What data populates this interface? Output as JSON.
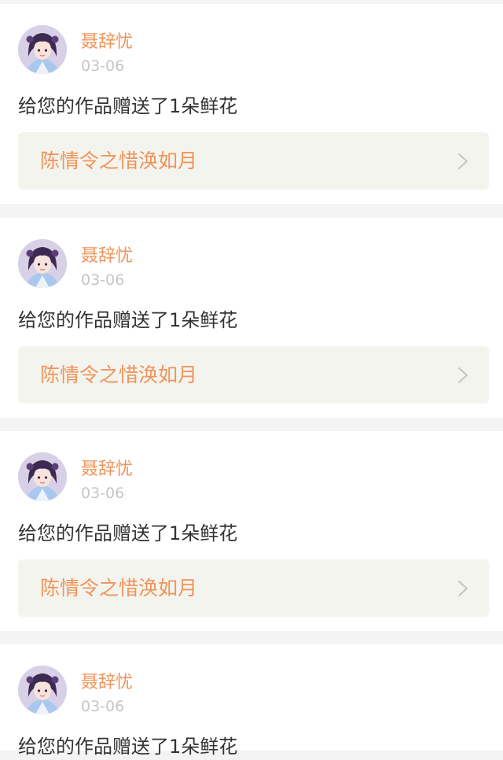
{
  "notifications": [
    {
      "username": "聂辞忧",
      "date": "03-06",
      "message": "给您的作品赠送了1朵鲜花",
      "work_title": "陈情令之惜涣如月"
    },
    {
      "username": "聂辞忧",
      "date": "03-06",
      "message": "给您的作品赠送了1朵鲜花",
      "work_title": "陈情令之惜涣如月"
    },
    {
      "username": "聂辞忧",
      "date": "03-06",
      "message": "给您的作品赠送了1朵鲜花",
      "work_title": "陈情令之惜涣如月"
    },
    {
      "username": "聂辞忧",
      "date": "03-06",
      "message": "给您的作品赠送了1朵鲜花",
      "work_title": ""
    }
  ],
  "icons": {
    "avatar": "avatar-image",
    "link_arrow": "chevron-right-icon"
  },
  "colors": {
    "accent": "#f0945a",
    "page_background": "#f4f4f4",
    "card_background": "#ffffff",
    "link_background": "#f4f4ef",
    "date_text": "#c6c6c6",
    "body_text": "#333333"
  }
}
